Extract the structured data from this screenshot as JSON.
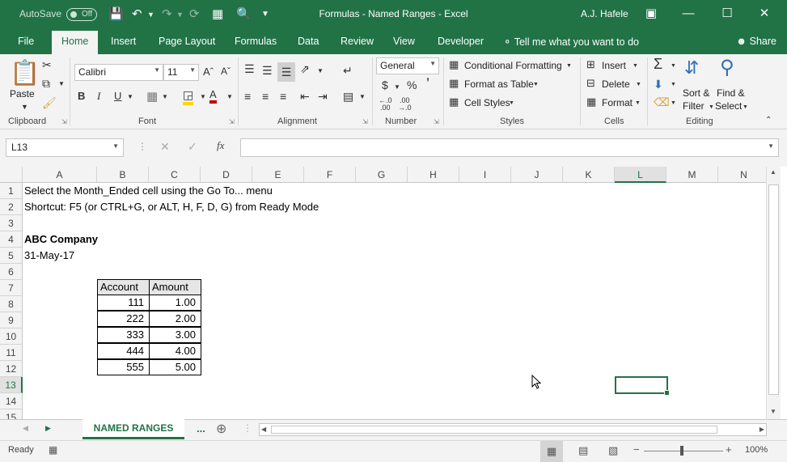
{
  "titlebar": {
    "autosave_label": "AutoSave",
    "autosave_state": "Off",
    "title": "Formulas - Named Ranges  -  Excel",
    "user": "A.J. Hafele"
  },
  "tabs": [
    "File",
    "Home",
    "Insert",
    "Page Layout",
    "Formulas",
    "Data",
    "Review",
    "View",
    "Developer"
  ],
  "tell_me": "Tell me what you want to do",
  "share": "Share",
  "ribbon": {
    "clipboard": {
      "paste": "Paste",
      "label": "Clipboard"
    },
    "font": {
      "name": "Calibri",
      "size": "11",
      "label": "Font"
    },
    "alignment": {
      "label": "Alignment"
    },
    "number": {
      "format": "General",
      "currency": "$",
      "percent": "%",
      "comma": "’",
      "label": "Number"
    },
    "styles": {
      "conditional": "Conditional Formatting",
      "format_table": "Format as Table",
      "cell_styles": "Cell Styles",
      "label": "Styles"
    },
    "cells": {
      "insert": "Insert",
      "delete": "Delete",
      "format": "Format",
      "label": "Cells"
    },
    "editing": {
      "sort_1": "Sort &",
      "sort_2": "Filter",
      "find_1": "Find &",
      "find_2": "Select",
      "label": "Editing"
    }
  },
  "formula_bar": {
    "name_box": "L13",
    "formula": ""
  },
  "columns": [
    "A",
    "B",
    "C",
    "D",
    "E",
    "F",
    "G",
    "H",
    "I",
    "J",
    "K",
    "L",
    "M",
    "N"
  ],
  "rows": [
    "1",
    "2",
    "3",
    "4",
    "5",
    "6",
    "7",
    "8",
    "9",
    "10",
    "11",
    "12",
    "13",
    "14",
    "15"
  ],
  "cells": {
    "a1": "Select the Month_Ended cell using the Go To... menu",
    "a2": "Shortcut: F5 (or CTRL+G, or ALT, H, F, D, G) from Ready Mode",
    "a4": "ABC Company",
    "a5": "31-May-17"
  },
  "table": {
    "headers": [
      "Account",
      "Amount"
    ],
    "rows": [
      [
        "111",
        "1.00"
      ],
      [
        "222",
        "2.00"
      ],
      [
        "333",
        "3.00"
      ],
      [
        "444",
        "4.00"
      ],
      [
        "555",
        "5.00"
      ]
    ]
  },
  "sheet": {
    "tab_name": "NAMED RANGES",
    "more": "..."
  },
  "status": {
    "mode": "Ready",
    "zoom": "100%"
  }
}
